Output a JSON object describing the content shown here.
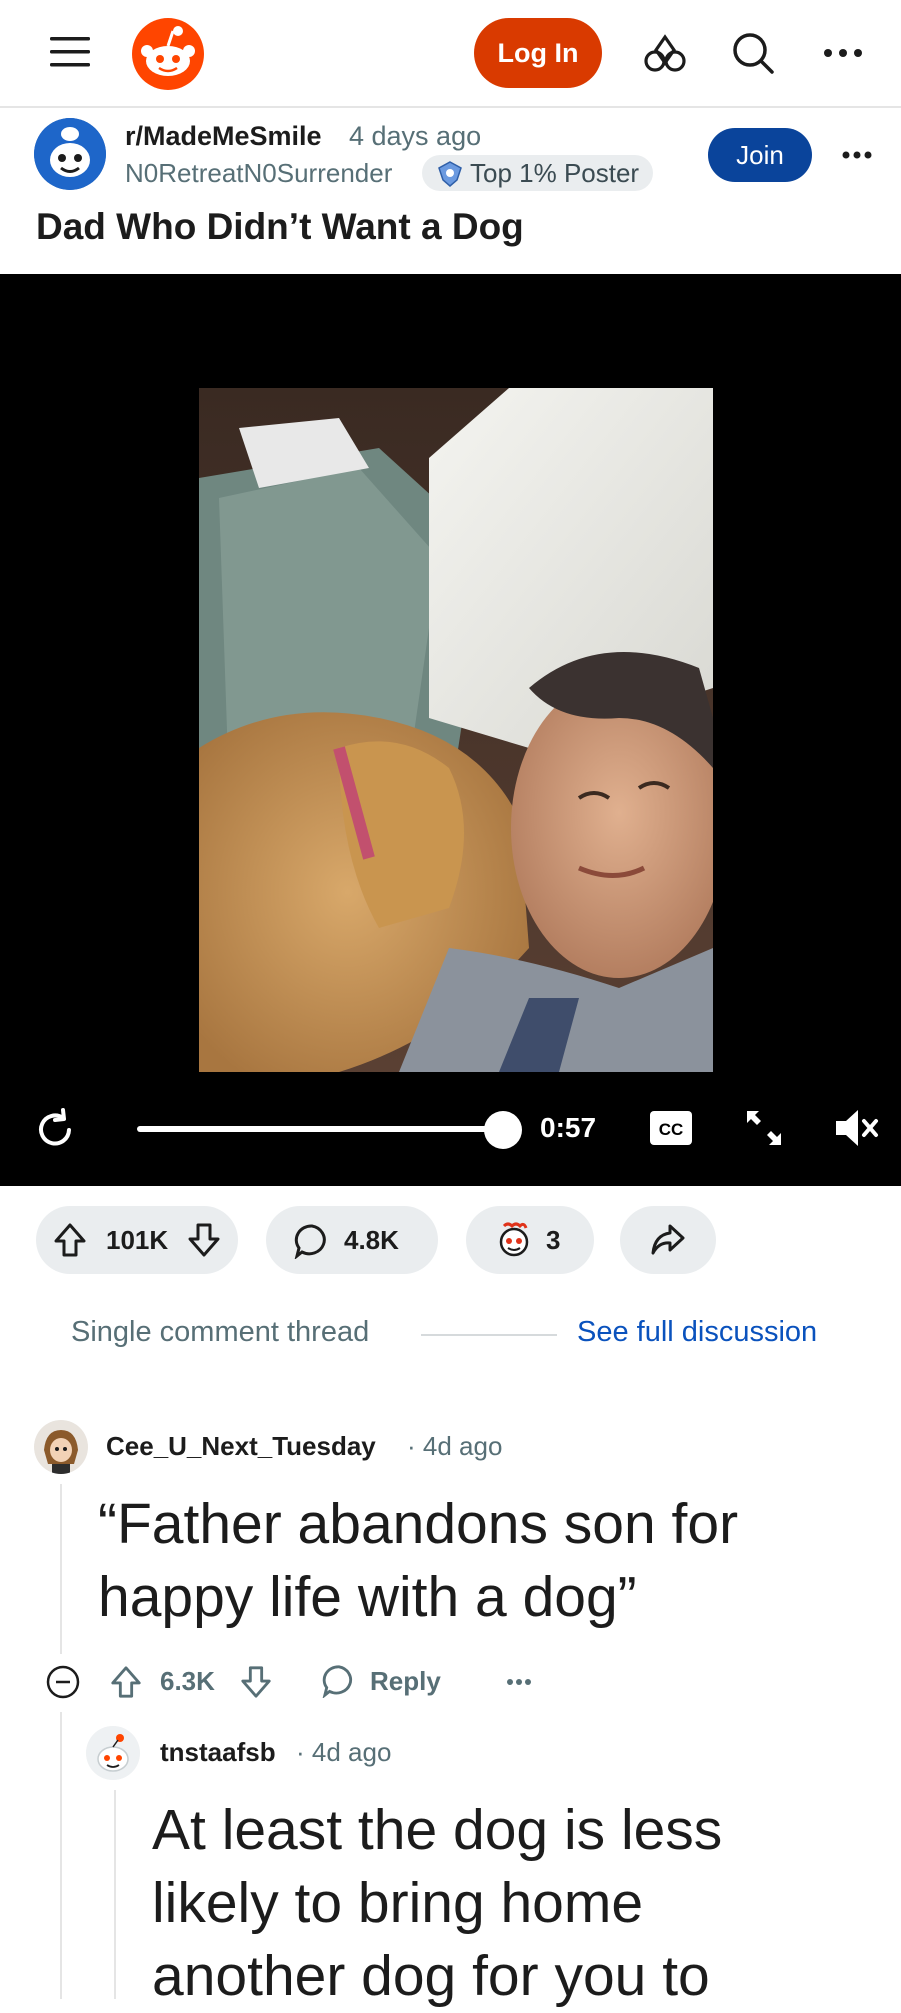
{
  "header": {
    "login_label": "Log In",
    "icons": [
      "menu-icon",
      "reddit-logo-icon",
      "advertise-icon",
      "search-icon",
      "more-icon"
    ]
  },
  "post": {
    "subreddit": "r/MadeMeSmile",
    "time": "4 days ago",
    "author": "N0RetreatN0Surrender",
    "flair": "Top 1% Poster",
    "join_label": "Join",
    "title": "Dad Who Didn’t Want a Dog",
    "video": {
      "time": "0:57",
      "progress": 1.0,
      "cc_label": "CC",
      "muted": true
    },
    "upvotes": "101K",
    "comments": "4.8K",
    "awards": "3"
  },
  "thread": {
    "single_label": "Single comment thread",
    "full_label": "See full discussion"
  },
  "comments": [
    {
      "user": "Cee_U_Next_Tuesday",
      "time": "4d ago",
      "body": "“Father abandons son for happy life with a dog”",
      "votes": "6.3K",
      "reply_label": "Reply"
    },
    {
      "user": "tnstaafsb",
      "time": "4d ago",
      "body": "At least the dog is less likely to bring home another dog for you to"
    }
  ],
  "colors": {
    "accent": "#d93a00",
    "join": "#0a449b",
    "link": "#0a52bd",
    "pill": "#eaedef"
  }
}
